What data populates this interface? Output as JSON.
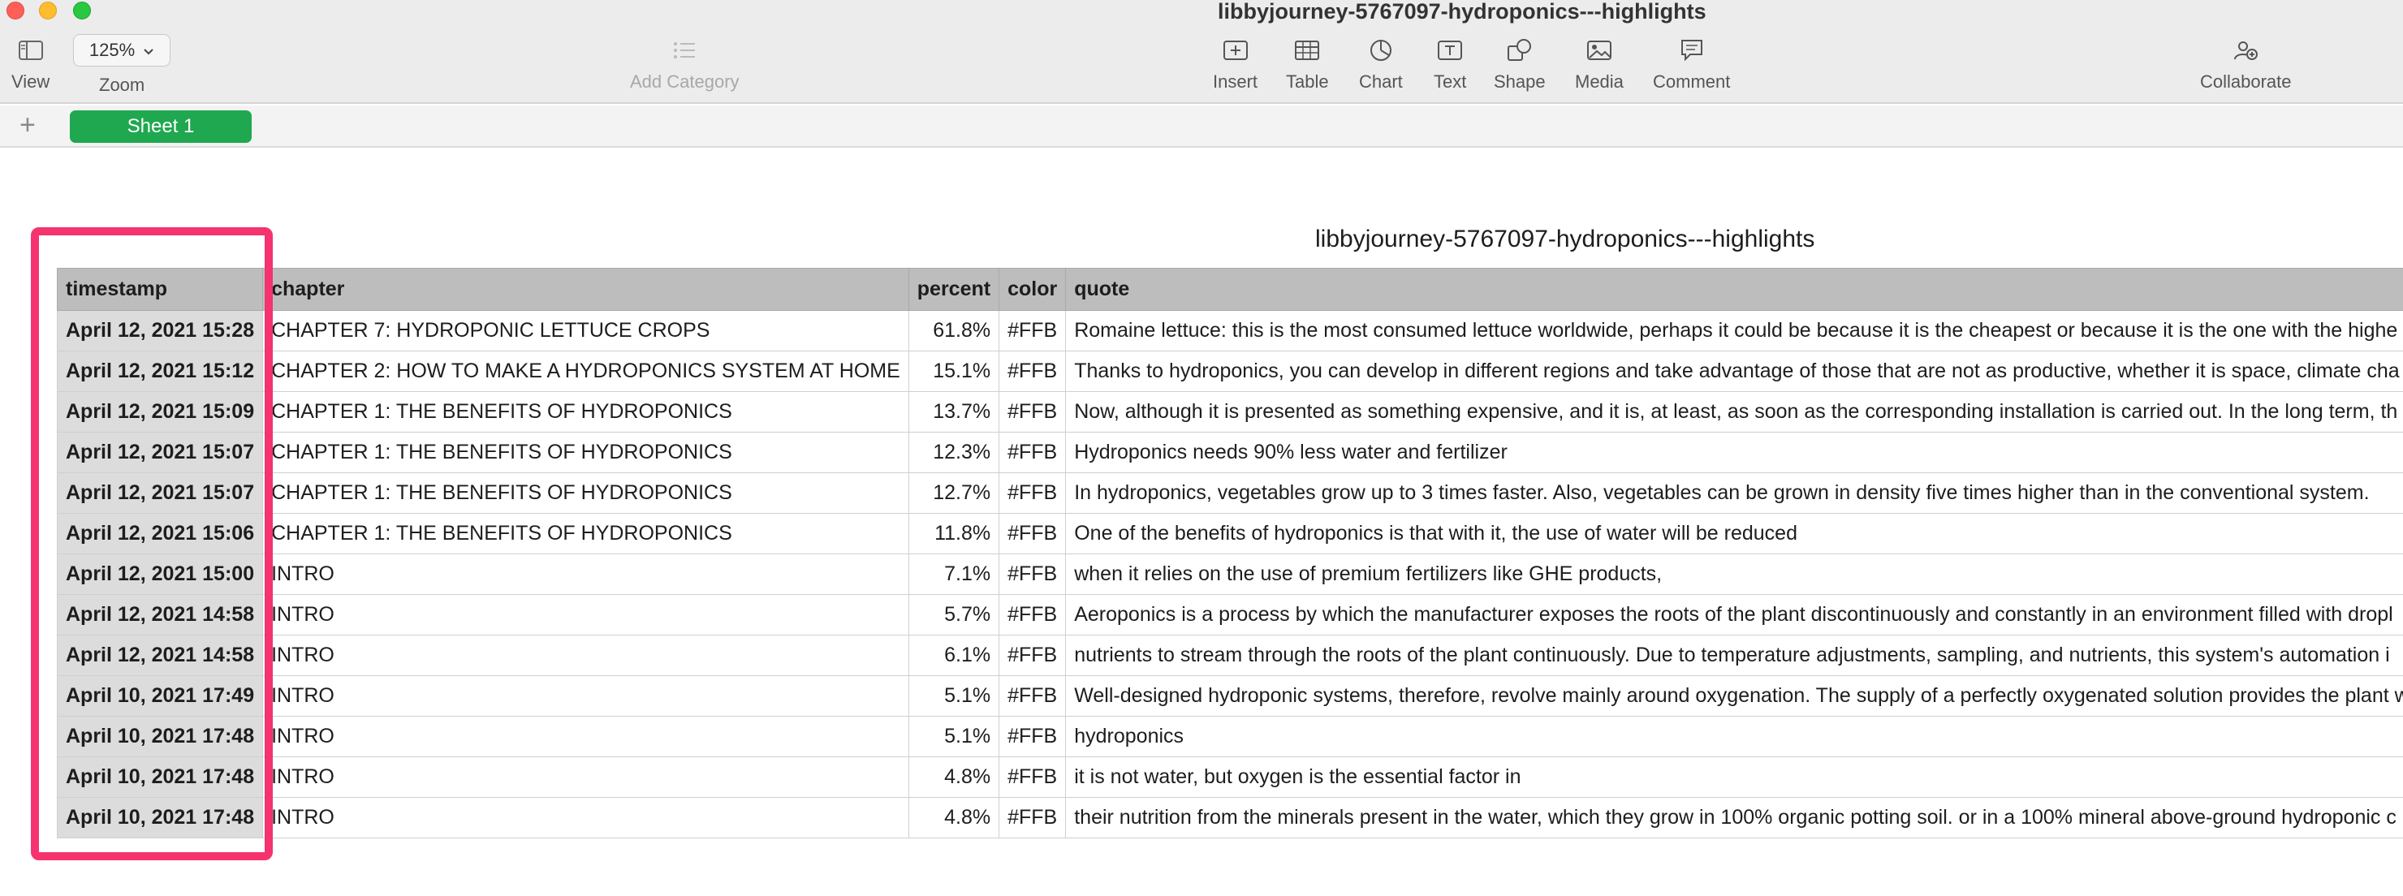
{
  "window": {
    "title": "libbyjourney-5767097-hydroponics---highlights"
  },
  "toolbar": {
    "view_label": "View",
    "zoom_value": "125%",
    "zoom_label": "Zoom",
    "add_category_label": "Add Category",
    "insert_label": "Insert",
    "table_label": "Table",
    "chart_label": "Chart",
    "text_label": "Text",
    "shape_label": "Shape",
    "media_label": "Media",
    "comment_label": "Comment",
    "collaborate_label": "Collaborate"
  },
  "sheets": {
    "add_symbol": "+",
    "active_tab": "Sheet 1"
  },
  "table": {
    "title": "libbyjourney-5767097-hydroponics---highlights",
    "columns": [
      "timestamp",
      "chapter",
      "percent",
      "color",
      "quote"
    ],
    "rows": [
      {
        "timestamp": "April 12, 2021 15:28",
        "chapter": "CHAPTER 7: HYDROPONIC LETTUCE CROPS",
        "percent": "61.8%",
        "color": "#FFB",
        "quote": "Romaine lettuce: this is the most consumed lettuce worldwide, perhaps it could be because it is the cheapest or because it is the one with the highe"
      },
      {
        "timestamp": "April 12, 2021 15:12",
        "chapter": "CHAPTER 2: HOW TO MAKE A HYDROPONICS SYSTEM AT HOME",
        "percent": "15.1%",
        "color": "#FFB",
        "quote": "Thanks to hydroponics, you can develop in different regions and take advantage of those that are not as productive, whether it is space, climate cha"
      },
      {
        "timestamp": "April 12, 2021 15:09",
        "chapter": "CHAPTER 1: THE BENEFITS OF HYDROPONICS",
        "percent": "13.7%",
        "color": "#FFB",
        "quote": "Now, although it is presented as something expensive, and it is, at least, as soon as the corresponding installation is carried out. In the long term, th"
      },
      {
        "timestamp": "April 12, 2021 15:07",
        "chapter": "CHAPTER 1: THE BENEFITS OF HYDROPONICS",
        "percent": "12.3%",
        "color": "#FFB",
        "quote": "Hydroponics needs 90% less water and fertilizer"
      },
      {
        "timestamp": "April 12, 2021 15:07",
        "chapter": "CHAPTER 1: THE BENEFITS OF HYDROPONICS",
        "percent": "12.7%",
        "color": "#FFB",
        "quote": "In hydroponics, vegetables grow up to 3 times faster. Also, vegetables can be grown in density five times higher than in the conventional system."
      },
      {
        "timestamp": "April 12, 2021 15:06",
        "chapter": "CHAPTER 1: THE BENEFITS OF HYDROPONICS",
        "percent": "11.8%",
        "color": "#FFB",
        "quote": "One of the benefits of hydroponics is that with it, the use of water will be reduced"
      },
      {
        "timestamp": "April 12, 2021 15:00",
        "chapter": "INTRO",
        "percent": "7.1%",
        "color": "#FFB",
        "quote": "when it relies on the use of premium fertilizers like GHE products,"
      },
      {
        "timestamp": "April 12, 2021 14:58",
        "chapter": "INTRO",
        "percent": "5.7%",
        "color": "#FFB",
        "quote": "Aeroponics is a process by which the manufacturer exposes the roots of the plant discontinuously and constantly in an environment filled with dropl"
      },
      {
        "timestamp": "April 12, 2021 14:58",
        "chapter": "INTRO",
        "percent": "6.1%",
        "color": "#FFB",
        "quote": "nutrients to stream through the roots of the plant continuously. Due to temperature adjustments, sampling, and nutrients, this system's automation i"
      },
      {
        "timestamp": "April 10, 2021 17:49",
        "chapter": "INTRO",
        "percent": "5.1%",
        "color": "#FFB",
        "quote": "Well-designed hydroponic systems, therefore, revolve mainly around oxygenation. The supply of a perfectly oxygenated solution provides the plant w"
      },
      {
        "timestamp": "April 10, 2021 17:48",
        "chapter": "INTRO",
        "percent": "5.1%",
        "color": "#FFB",
        "quote": "hydroponics"
      },
      {
        "timestamp": "April 10, 2021 17:48",
        "chapter": "INTRO",
        "percent": "4.8%",
        "color": "#FFB",
        "quote": "it is not water, but oxygen is the essential factor in"
      },
      {
        "timestamp": "April 10, 2021 17:48",
        "chapter": "INTRO",
        "percent": "4.8%",
        "color": "#FFB",
        "quote": "their nutrition from the minerals present in the water, which they grow in 100% organic potting soil. or in a 100% mineral above-ground hydroponic c"
      }
    ]
  },
  "colors": {
    "highlight_border": "#f4336f",
    "sheet_tab": "#1fa84f",
    "header_fill": "#bdbdbd",
    "timestamp_fill": "#dcdcdc"
  }
}
